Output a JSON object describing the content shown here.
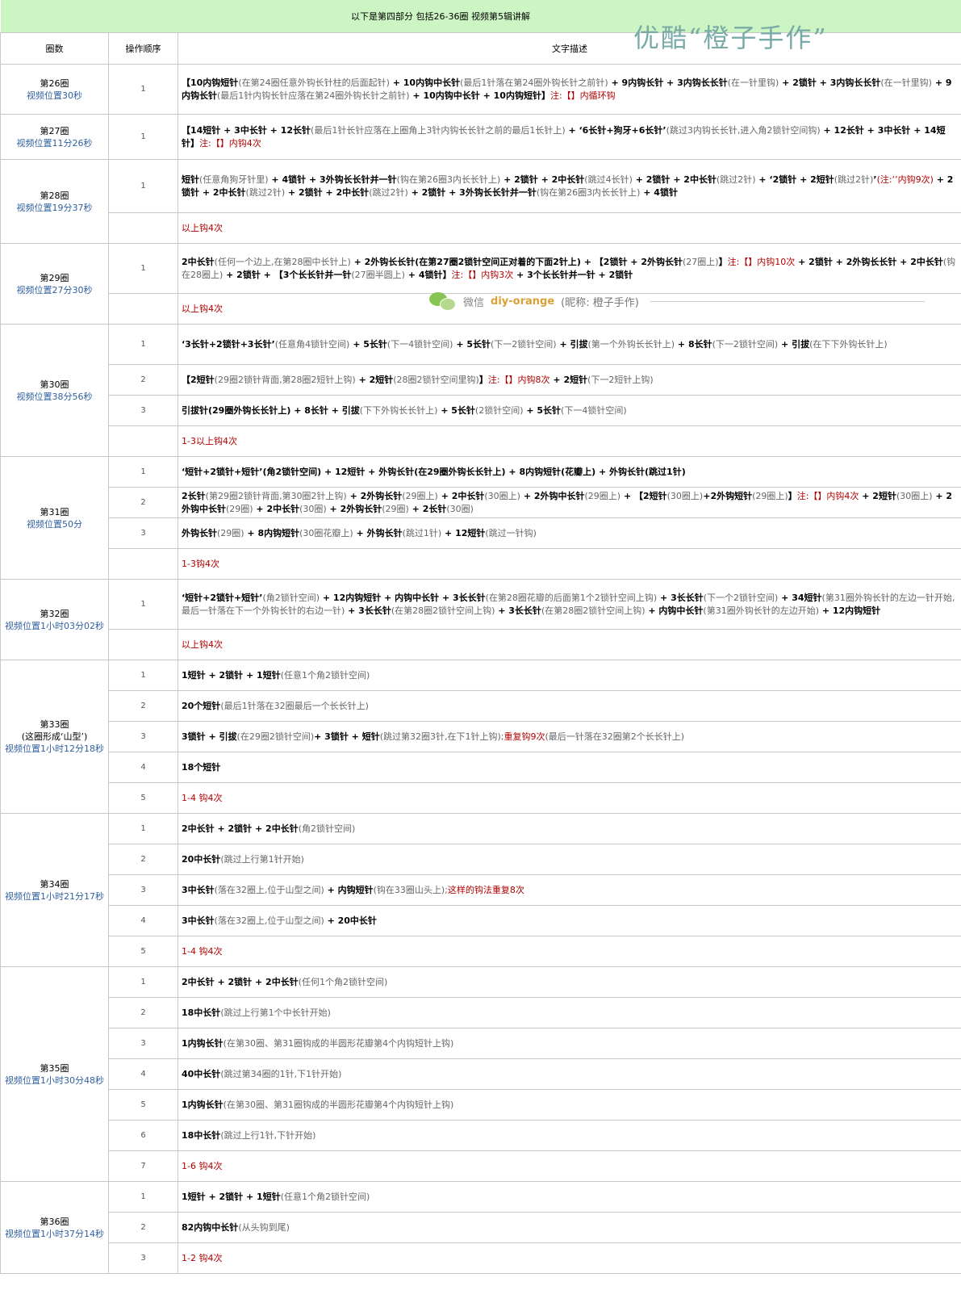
{
  "title": "以下是第四部分 包括26-36圈    视频第5辑讲解",
  "watermark": "优酷“橙子手作”",
  "headers": {
    "round": "圈数",
    "step": "操作顺序",
    "desc": "文字描述"
  },
  "wechat": {
    "label": "微信",
    "id": "diy-orange",
    "nick": "(昵称: 橙子手作)"
  },
  "rounds": [
    {
      "name": "第26圈",
      "note": "",
      "video": "视频位置30秒",
      "rowHeight": [
        62
      ],
      "steps": [
        {
          "num": "1",
          "segs": [
            [
              "b",
              "【10内钩短针"
            ],
            [
              "g",
              "(在第24圈任意外钩长针柱的后面起针)"
            ],
            [
              "b",
              " + 10内钩中长针"
            ],
            [
              "g",
              "(最后1针落在第24圈外钩长针之前针)"
            ],
            [
              "b",
              " + 9内钩长针 + 3内钩长长针"
            ],
            [
              "g",
              "(在一针里钩)"
            ],
            [
              "b",
              " + 2锁针 + 3内钩长长针"
            ],
            [
              "g",
              "(在一针里钩)"
            ],
            [
              "b",
              " + 9内钩长针"
            ],
            [
              "g",
              "(最后1针内钩长针应落在第24圈外钩长针之前针)"
            ],
            [
              "b",
              " + 10内钩中长针 + 10内钩短针】"
            ],
            [
              "r",
              "注:【】内循环钩"
            ]
          ]
        }
      ]
    },
    {
      "name": "第27圈",
      "note": "",
      "video": "视频位置11分26秒",
      "rowHeight": [
        56
      ],
      "steps": [
        {
          "num": "1",
          "segs": [
            [
              "b",
              "【14短针 + 3中长针 + 12长针"
            ],
            [
              "g",
              "(最后1针长针应落在上圈角上3针内钩长长针之前的最后1长针上)"
            ],
            [
              "b",
              " + ‘6长针+狗牙+6长针’"
            ],
            [
              "g",
              "(跳过3内钩长长针,进入角2锁针空间钩)"
            ],
            [
              "b",
              " + 12长针 + 3中长针 + 14短针】"
            ],
            [
              "r",
              "注:【】内钩4次"
            ]
          ]
        }
      ]
    },
    {
      "name": "第28圈",
      "note": "",
      "video": "视频位置19分37秒",
      "rowHeight": [
        66,
        38
      ],
      "steps": [
        {
          "num": "1",
          "segs": [
            [
              "b",
              "短针"
            ],
            [
              "g",
              "(任意角狗牙针里)"
            ],
            [
              "b",
              " + 4锁针 + 3外钩长长针并一针"
            ],
            [
              "g",
              "(钩在第26圈3内长长针上)"
            ],
            [
              "b",
              " + 2锁针 + 2中长针"
            ],
            [
              "g",
              "(跳过4长针)"
            ],
            [
              "b",
              " + 2锁针 + 2中长针"
            ],
            [
              "g",
              "(跳过2针)"
            ],
            [
              "b",
              " + ‘2锁针 + 2短针"
            ],
            [
              "g",
              "(跳过2针)"
            ],
            [
              "b",
              "’"
            ],
            [
              "r",
              "(注:‘’内钩9次)"
            ],
            [
              "b",
              " + 2锁针 + 2中长针"
            ],
            [
              "g",
              "(跳过2针)"
            ],
            [
              "b",
              " + 2锁针 + 2中长针"
            ],
            [
              "g",
              "(跳过2针)"
            ],
            [
              "b",
              " + 2锁针 + 3外钩长长针并一针"
            ],
            [
              "g",
              "(钩在第26圈3内长长针上)"
            ],
            [
              "b",
              " + 4锁针"
            ]
          ]
        },
        {
          "num": "",
          "segs": [
            [
              "r",
              "以上钩4次"
            ]
          ]
        }
      ]
    },
    {
      "name": "第29圈",
      "note": "",
      "video": "视频位置27分30秒",
      "rowHeight": [
        62,
        38
      ],
      "steps": [
        {
          "num": "1",
          "segs": [
            [
              "b",
              "2中长针"
            ],
            [
              "g",
              "(任何一个边上,在第28圈中长针上)"
            ],
            [
              "b",
              " + 2外钩长长针(在第27圈2锁针空间正对着的下面2针上) + 【2锁针 + 2外钩长针"
            ],
            [
              "g",
              "(27圈上)"
            ],
            [
              "b",
              "】"
            ],
            [
              "r",
              "注:【】内钩10次"
            ],
            [
              "b",
              " + 2锁针 + 2外钩长长针 + 2中长针"
            ],
            [
              "g",
              "(钩在28圈上)"
            ],
            [
              "b",
              " + 2锁针 + 【3个长长针并一针"
            ],
            [
              "g",
              "(27圈半圆上)"
            ],
            [
              "b",
              " + 4锁针】"
            ],
            [
              "r",
              "注:【】内钩3次"
            ],
            [
              "b",
              " + 3个长长针并一针 + 2锁针"
            ]
          ]
        },
        {
          "num": "",
          "segs": [
            [
              "r",
              "以上钩4次"
            ]
          ]
        }
      ]
    },
    {
      "name": "第30圈",
      "note": "",
      "video": "视频位置38分56秒",
      "rowHeight": [
        50,
        38,
        38,
        38
      ],
      "steps": [
        {
          "num": "1",
          "segs": [
            [
              "b",
              "‘3长针+2锁针+3长针’"
            ],
            [
              "g",
              "(任意角4锁针空间)"
            ],
            [
              "b",
              " + 5长针"
            ],
            [
              "g",
              "(下一4锁针空间)"
            ],
            [
              "b",
              " + 5长针"
            ],
            [
              "g",
              "(下一2锁针空间)"
            ],
            [
              "b",
              " + 引拔"
            ],
            [
              "g",
              "(第一个外钩长长针上)"
            ],
            [
              "b",
              " + 8长针"
            ],
            [
              "g",
              "(下一2锁针空间)"
            ],
            [
              "b",
              " + 引拔"
            ],
            [
              "g",
              "(在下下外钩长针上)"
            ]
          ]
        },
        {
          "num": "2",
          "segs": [
            [
              "b",
              "【2短针"
            ],
            [
              "g",
              "(29圈2锁针背面,第28圈2短针上钩)"
            ],
            [
              "b",
              " + 2短针"
            ],
            [
              "g",
              "(28圈2锁针空间里钩)"
            ],
            [
              "b",
              "】"
            ],
            [
              "r",
              "注:【】内钩8次"
            ],
            [
              "b",
              " + 2短针"
            ],
            [
              "g",
              "(下一2短针上钩)"
            ]
          ]
        },
        {
          "num": "3",
          "segs": [
            [
              "b",
              "引拔针(29圈外钩长长针上) + 8长针 + 引拔"
            ],
            [
              "g",
              "(下下外钩长长针上)"
            ],
            [
              "b",
              " + 5长针"
            ],
            [
              "g",
              "(2锁针空间)"
            ],
            [
              "b",
              " + 5长针"
            ],
            [
              "g",
              "(下一4锁针空间)"
            ]
          ]
        },
        {
          "num": "",
          "segs": [
            [
              "r",
              "1-3以上钩4次"
            ]
          ]
        }
      ]
    },
    {
      "name": "第31圈",
      "note": "",
      "video": "视频位置50分",
      "rowHeight": [
        38,
        38,
        38,
        38
      ],
      "steps": [
        {
          "num": "1",
          "segs": [
            [
              "b",
              "‘短针+2锁针+短针’(角2锁针空间) + 12短针 + 外钩长针(在29圈外钩长长针上) + 8内钩短针(花瓣上) + 外钩长针(跳过1针)"
            ]
          ]
        },
        {
          "num": "2",
          "segs": [
            [
              "b",
              "2长针"
            ],
            [
              "g",
              "(第29圈2锁针背面,第30圈2针上钩)"
            ],
            [
              "b",
              " + 2外钩长针"
            ],
            [
              "g",
              "(29圈上)"
            ],
            [
              "b",
              " + 2中长针"
            ],
            [
              "g",
              "(30圈上)"
            ],
            [
              "b",
              " + 2外钩中长针"
            ],
            [
              "g",
              "(29圈上)"
            ],
            [
              "b",
              " + 【2短针"
            ],
            [
              "g",
              "(30圈上)"
            ],
            [
              "b",
              "+2外钩短针"
            ],
            [
              "g",
              "(29圈上)"
            ],
            [
              "b",
              "】"
            ],
            [
              "r",
              "注:【】内钩4次"
            ],
            [
              "b",
              " + 2短针"
            ],
            [
              "g",
              "(30圈上)"
            ],
            [
              "b",
              " + 2外钩中长针"
            ],
            [
              "g",
              "(29圈)"
            ],
            [
              "b",
              " + 2中长针"
            ],
            [
              "g",
              "(30圈)"
            ],
            [
              "b",
              " + 2外钩长针"
            ],
            [
              "g",
              "(29圈)"
            ],
            [
              "b",
              " + 2长针"
            ],
            [
              "g",
              "(30圈)"
            ]
          ]
        },
        {
          "num": "3",
          "segs": [
            [
              "b",
              "外钩长针"
            ],
            [
              "g",
              "(29圈)"
            ],
            [
              "b",
              " + 8内钩短针"
            ],
            [
              "g",
              "(30圈花瓣上)"
            ],
            [
              "b",
              " + 外钩长针"
            ],
            [
              "g",
              "(跳过1针)"
            ],
            [
              "b",
              " + 12短针"
            ],
            [
              "g",
              "(跳过一针钩)"
            ]
          ]
        },
        {
          "num": "",
          "segs": [
            [
              "r",
              "1-3钩4次"
            ]
          ]
        }
      ]
    },
    {
      "name": "第32圈",
      "note": "",
      "video": "视频位置1小时03分02秒",
      "rowHeight": [
        62,
        38
      ],
      "steps": [
        {
          "num": "1",
          "segs": [
            [
              "b",
              "‘短针+2锁针+短针’"
            ],
            [
              "g",
              "(角2锁针空间)"
            ],
            [
              "b",
              " + 12内钩短针 + 内钩中长针 + 3长长针"
            ],
            [
              "g",
              "(在第28圈花瓣的后面第1个2锁针空间上钩)"
            ],
            [
              "b",
              " + 3长长针"
            ],
            [
              "g",
              "(下一个2锁针空间)"
            ],
            [
              "b",
              " + 34短针"
            ],
            [
              "g",
              "(第31圈外钩长针的左边一针开始,最后一针落在下一个外钩长针的右边一针)"
            ],
            [
              "b",
              " + 3长长针"
            ],
            [
              "g",
              "(在第28圈2锁针空间上钩)"
            ],
            [
              "b",
              " + 3长长针"
            ],
            [
              "g",
              "(在第28圈2锁针空间上钩)"
            ],
            [
              "b",
              " + 内钩中长针"
            ],
            [
              "g",
              "(第31圈外钩长针的左边开始)"
            ],
            [
              "b",
              " + 12内钩短针"
            ]
          ]
        },
        {
          "num": "",
          "segs": [
            [
              "r",
              "以上钩4次"
            ]
          ]
        }
      ]
    },
    {
      "name": "第33圈",
      "note": "(这圈形成‘山型’)",
      "video": "视频位置1小时12分18秒",
      "rowHeight": [
        38,
        38,
        38,
        38,
        38
      ],
      "steps": [
        {
          "num": "1",
          "segs": [
            [
              "b",
              "1短针 + 2锁针 + 1短针"
            ],
            [
              "g",
              "(任意1个角2锁针空间)"
            ]
          ]
        },
        {
          "num": "2",
          "segs": [
            [
              "b",
              "20个短针"
            ],
            [
              "g",
              "(最后1针落在32圈最后一个长长针上)"
            ]
          ]
        },
        {
          "num": "3",
          "segs": [
            [
              "b",
              "3锁针 + 引拔"
            ],
            [
              "g",
              "(在29圈2锁针空间)"
            ],
            [
              "b",
              "+ 3锁针 + 短针"
            ],
            [
              "g",
              "(跳过第32圈3针,在下1针上钩);"
            ],
            [
              "r",
              "重复钩9次"
            ],
            [
              "g",
              "(最后一针落在32圈第2个长长针上)"
            ]
          ]
        },
        {
          "num": "4",
          "segs": [
            [
              "b",
              "18个短针"
            ]
          ]
        },
        {
          "num": "5",
          "segs": [
            [
              "r",
              "1-4 钩4次"
            ]
          ]
        }
      ]
    },
    {
      "name": "第34圈",
      "note": "",
      "video": "视频位置1小时21分17秒",
      "rowHeight": [
        38,
        38,
        38,
        38,
        38
      ],
      "steps": [
        {
          "num": "1",
          "segs": [
            [
              "b",
              "2中长针 + 2锁针 + 2中长针"
            ],
            [
              "g",
              "(角2锁针空间)"
            ]
          ]
        },
        {
          "num": "2",
          "segs": [
            [
              "b",
              "20中长针"
            ],
            [
              "g",
              "(跳过上行第1针开始)"
            ]
          ]
        },
        {
          "num": "3",
          "segs": [
            [
              "b",
              "3中长针"
            ],
            [
              "g",
              "(落在32圈上,位于山型之间)"
            ],
            [
              "b",
              " + 内钩短针"
            ],
            [
              "g",
              "(钩在33圈山头上);"
            ],
            [
              "r",
              "这样的钩法重复8次"
            ]
          ]
        },
        {
          "num": "4",
          "segs": [
            [
              "b",
              "3中长针"
            ],
            [
              "g",
              "(落在32圈上,位于山型之间)"
            ],
            [
              "b",
              " + 20中长针"
            ]
          ]
        },
        {
          "num": "5",
          "segs": [
            [
              "r",
              "1-4 钩4次"
            ]
          ]
        }
      ]
    },
    {
      "name": "第35圈",
      "note": "",
      "video": "视频位置1小时30分48秒",
      "rowHeight": [
        38,
        38,
        38,
        38,
        38,
        38,
        38
      ],
      "steps": [
        {
          "num": "1",
          "segs": [
            [
              "b",
              "2中长针 + 2锁针 + 2中长针"
            ],
            [
              "g",
              "(任何1个角2锁针空间)"
            ]
          ]
        },
        {
          "num": "2",
          "segs": [
            [
              "b",
              "18中长针"
            ],
            [
              "g",
              "(跳过上行第1个中长针开始)"
            ]
          ]
        },
        {
          "num": "3",
          "segs": [
            [
              "b",
              "1内钩长针"
            ],
            [
              "g",
              "(在第30圈、第31圈钩成的半圆形花瓣第4个内钩短针上钩)"
            ]
          ]
        },
        {
          "num": "4",
          "segs": [
            [
              "b",
              "40中长针"
            ],
            [
              "g",
              "(跳过第34圈的1针,下1针开始)"
            ]
          ]
        },
        {
          "num": "5",
          "segs": [
            [
              "b",
              "1内钩长针"
            ],
            [
              "g",
              "(在第30圈、第31圈钩成的半圆形花瓣第4个内钩短针上钩)"
            ]
          ]
        },
        {
          "num": "6",
          "segs": [
            [
              "b",
              "18中长针"
            ],
            [
              "g",
              "(跳过上行1针,下针开始)"
            ]
          ]
        },
        {
          "num": "7",
          "segs": [
            [
              "r",
              "1-6 钩4次"
            ]
          ]
        }
      ]
    },
    {
      "name": "第36圈",
      "note": "",
      "video": "视频位置1小时37分14秒",
      "rowHeight": [
        38,
        38,
        38
      ],
      "steps": [
        {
          "num": "1",
          "segs": [
            [
              "b",
              "1短针 + 2锁针 + 1短针"
            ],
            [
              "g",
              "(任意1个角2锁针空间)"
            ]
          ]
        },
        {
          "num": "2",
          "segs": [
            [
              "b",
              "82内钩中长针"
            ],
            [
              "g",
              "(从头钩到尾)"
            ]
          ]
        },
        {
          "num": "3",
          "segs": [
            [
              "r",
              "1-2 钩4次"
            ]
          ]
        }
      ]
    }
  ]
}
